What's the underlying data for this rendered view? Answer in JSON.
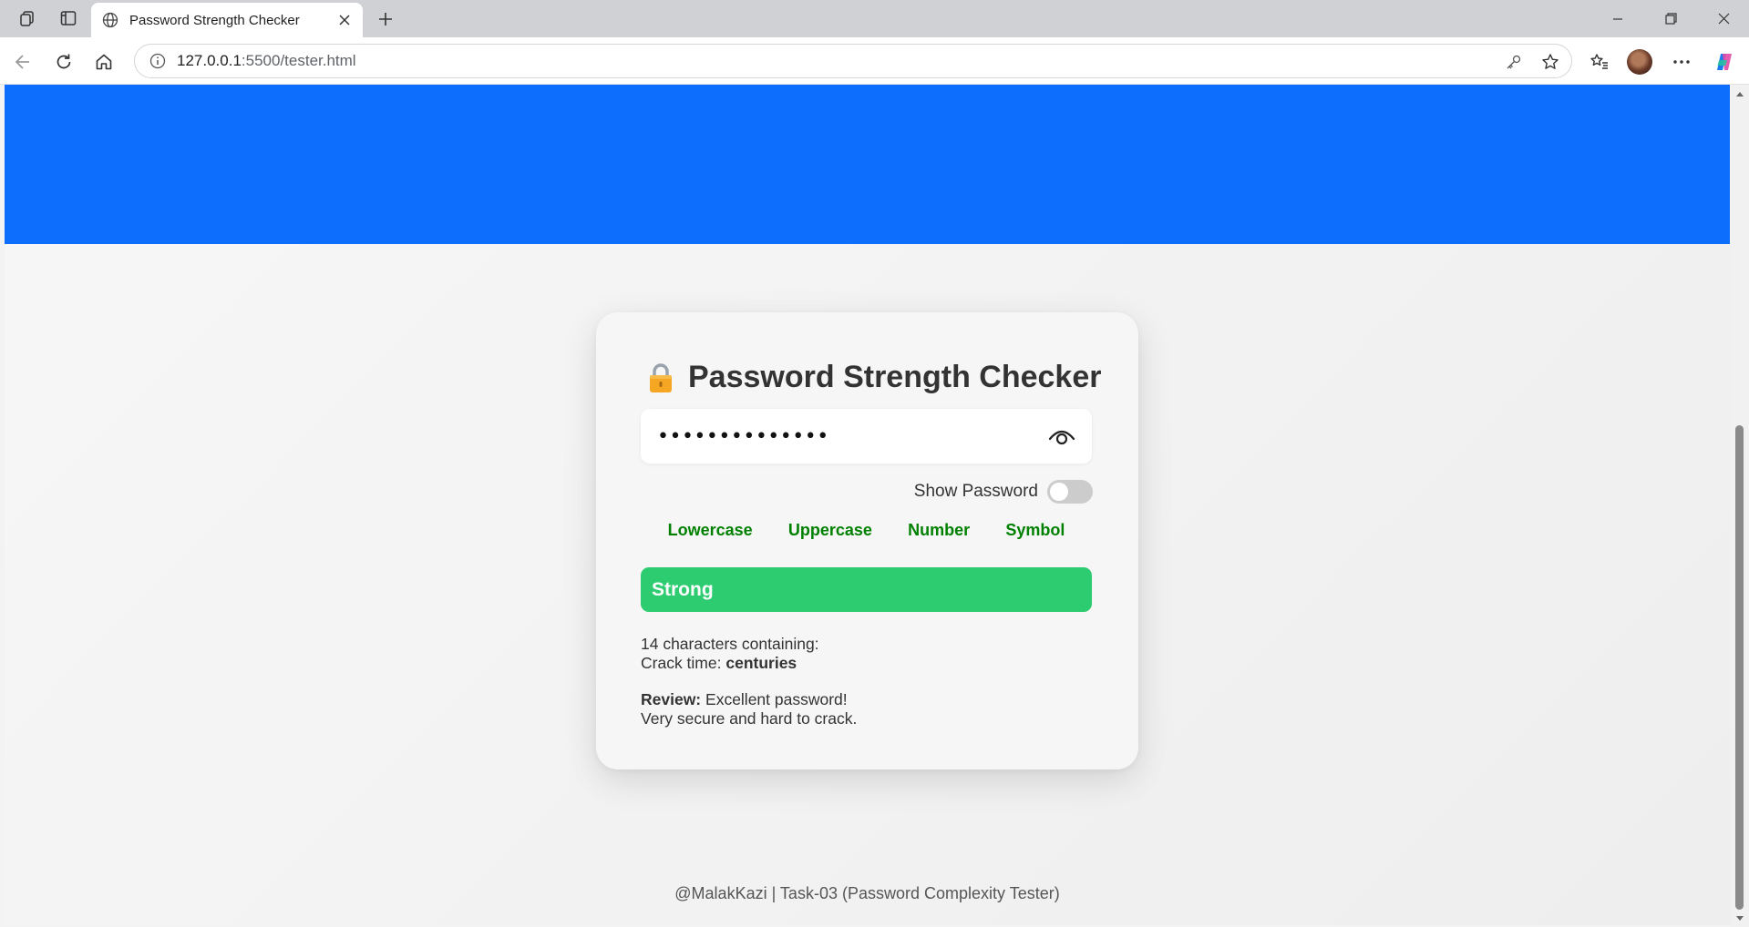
{
  "browser": {
    "tab_title": "Password Strength Checker",
    "url_host": "127.0.0.1",
    "url_path": ":5500/tester.html"
  },
  "card": {
    "title": "Password Strength Checker",
    "password_masked": "••••••••••••••",
    "show_password_label": "Show Password",
    "show_password_on": false,
    "criteria": [
      {
        "label": "Lowercase",
        "met": true
      },
      {
        "label": "Uppercase",
        "met": true
      },
      {
        "label": "Number",
        "met": true
      },
      {
        "label": "Symbol",
        "met": true
      }
    ],
    "strength": {
      "label": "Strong",
      "level": 1.0
    },
    "chars_text": "14 characters containing:",
    "crack_label": "Crack time:",
    "crack_value": "centuries",
    "review_label": "Review:",
    "review_line1": "Excellent password!",
    "review_line2": "Very secure and hard to crack."
  },
  "footer": {
    "text": "@MalakKazi | Task-03 (Password Complexity Tester)"
  },
  "colors": {
    "banner": "#0d6efd",
    "strong": "#2ecc71",
    "criteria_met": "#008000"
  },
  "icons": [
    "workspaces-icon",
    "vertical-tabs-icon",
    "globe-icon",
    "close-icon",
    "plus-icon",
    "minimize-icon",
    "restore-icon",
    "window-close-icon",
    "back-icon",
    "refresh-icon",
    "home-icon",
    "info-icon",
    "key-icon",
    "star-icon",
    "favorites-icon",
    "more-icon",
    "copilot-icon",
    "lock-icon",
    "eye-icon"
  ]
}
